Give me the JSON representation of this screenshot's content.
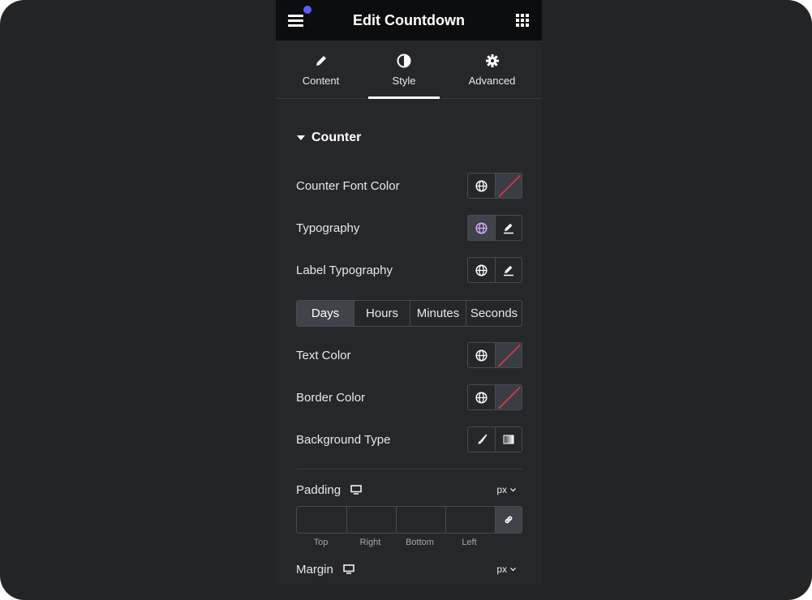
{
  "header": {
    "title": "Edit Countdown"
  },
  "tabs": [
    {
      "label": "Content",
      "icon": "pencil-icon"
    },
    {
      "label": "Style",
      "icon": "contrast-icon"
    },
    {
      "label": "Advanced",
      "icon": "gear-icon"
    }
  ],
  "section": {
    "title": "Counter"
  },
  "controls": {
    "counter_font_color": "Counter Font Color",
    "typography": "Typography",
    "label_typography": "Label Typography",
    "text_color": "Text Color",
    "border_color": "Border Color",
    "background_type": "Background Type"
  },
  "unit_tabs": [
    "Days",
    "Hours",
    "Minutes",
    "Seconds"
  ],
  "padding": {
    "label": "Padding",
    "unit": "px"
  },
  "margin": {
    "label": "Margin",
    "unit": "px"
  },
  "dimension_labels": [
    "Top",
    "Right",
    "Bottom",
    "Left"
  ],
  "colors": {
    "accent": "#5c5cf5",
    "swatch_slash": "#c7384a"
  }
}
